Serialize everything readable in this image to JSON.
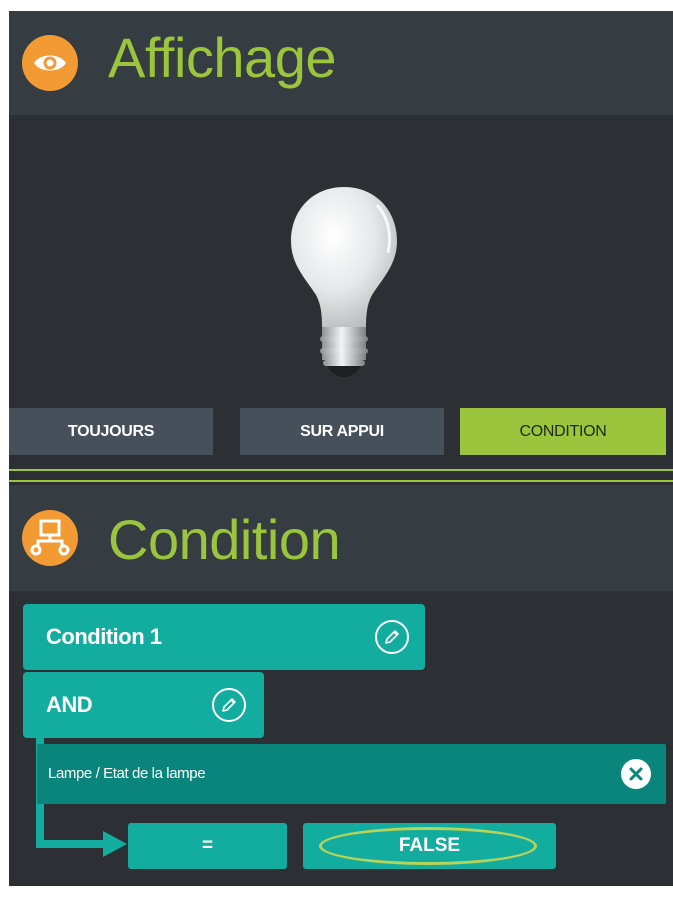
{
  "display_section": {
    "title": "Affichage",
    "icon": "eye-icon",
    "preview_icon": "lightbulb-icon",
    "modes": [
      {
        "label": "TOUJOURS",
        "active": false
      },
      {
        "label": "SUR APPUI",
        "active": false
      },
      {
        "label": "CONDITION",
        "active": true
      }
    ]
  },
  "condition_section": {
    "title": "Condition",
    "icon": "flow-diagram-icon",
    "condition_block": {
      "label": "Condition 1"
    },
    "operator_block": {
      "label": "AND"
    },
    "expression": {
      "label": "Lampe / Etat de la lampe"
    },
    "comparator": "=",
    "value": "FALSE"
  },
  "colors": {
    "accent_green": "#9bc53d",
    "orange": "#f29a33",
    "teal": "#13ad9f",
    "dark_teal": "#09857c",
    "panel_bg": "#2c3035",
    "header_bg": "#353c42",
    "button_bg": "#46505a"
  }
}
